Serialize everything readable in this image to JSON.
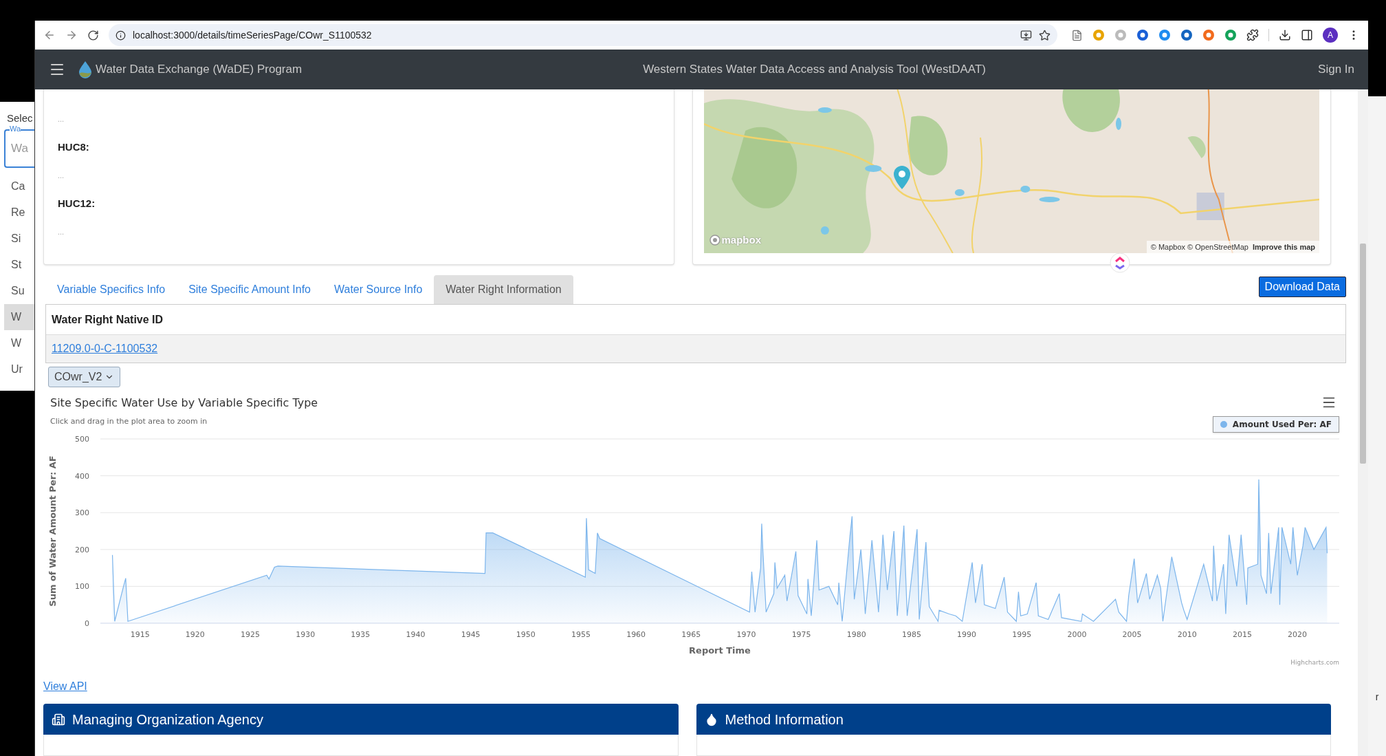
{
  "background_window": {
    "heading": "Selec",
    "field_label": "Wa",
    "field_placeholder": "Wa",
    "items": [
      {
        "label": "Ca",
        "selected": false
      },
      {
        "label": "Re",
        "selected": false
      },
      {
        "label": "Si",
        "selected": false
      },
      {
        "label": "St",
        "selected": false
      },
      {
        "label": "Su",
        "selected": false
      },
      {
        "label": "W",
        "selected": true
      },
      {
        "label": "W",
        "selected": false
      },
      {
        "label": "Ur",
        "selected": false
      }
    ],
    "side_text": "r"
  },
  "browser": {
    "url": "localhost:3000/details/timeSeriesPage/COwr_S1100532",
    "avatar": "A"
  },
  "navbar": {
    "brand": "Water Data Exchange (WaDE) Program",
    "title": "Western States Water Data Access and Analysis Tool (WestDAAT)",
    "sign_in": "Sign In"
  },
  "site_card": {
    "items": [
      {
        "kind": "value",
        "text": "..."
      },
      {
        "kind": "label",
        "text": "HUC8:"
      },
      {
        "kind": "value",
        "text": "..."
      },
      {
        "kind": "label",
        "text": "HUC12:"
      },
      {
        "kind": "value",
        "text": "..."
      }
    ]
  },
  "map": {
    "logo": "mapbox",
    "attribution": "© Mapbox © OpenStreetMap",
    "improve_link": "Improve this map"
  },
  "tabs": [
    {
      "label": "Variable Specifics Info",
      "selected": false
    },
    {
      "label": "Site Specific Amount Info",
      "selected": false
    },
    {
      "label": "Water Source Info",
      "selected": false
    },
    {
      "label": "Water Right Information",
      "selected": true
    }
  ],
  "download_button": "Download Data",
  "table": {
    "columns": [
      "Water Right Native ID"
    ],
    "rows": [
      [
        "11209.0-0-C-1100532"
      ]
    ]
  },
  "version_select": {
    "value": "COwr_V2"
  },
  "chart": {
    "subtitle": "Click and drag in the plot area to zoom in",
    "credit": "Highcharts.com",
    "chart_data": {
      "type": "area",
      "title": "Site Specific Water Use by Variable Specific Type",
      "xlabel": "Report Time",
      "ylabel": "Sum of Water Amount Per: AF",
      "x": [
        1912.5,
        1912.7,
        1913.5,
        1913.7,
        1913.9,
        1926.5,
        1926.7,
        1927.2,
        1927.5,
        1946.3,
        1946.4,
        1947,
        1955.4,
        1955.5,
        1955.7,
        1956.3,
        1956.5,
        1956.7,
        1970.3,
        1970.5,
        1970.8,
        1971.3,
        1971.4,
        1971.5,
        1971.8,
        1972.5,
        1972.6,
        1972.8,
        1973.5,
        1973.7,
        1974.5,
        1974.7,
        1975.5,
        1975.6,
        1975.9,
        1976.4,
        1976.6,
        1977.5,
        1978.3,
        1978.4,
        1978.7,
        1979.4,
        1979.6,
        1979.8,
        1980.4,
        1980.6,
        1980.8,
        1981.4,
        1982,
        1982.4,
        1982.8,
        1983.4,
        1983.7,
        1984.3,
        1984.6,
        1985.5,
        1985.7,
        1986.3,
        1986.6,
        1987.4,
        1987.5,
        1988.4,
        1989,
        1989.6,
        1990.5,
        1990.8,
        1991.4,
        1991.6,
        1992.6,
        1993.4,
        1993.7,
        1994.5,
        1994.7,
        1994.9,
        1995.5,
        1996.3,
        1996.5,
        1997.4,
        1998.4,
        1998.6,
        2000.4,
        2000.5,
        2001.5,
        2003.5,
        2003.8,
        2004.5,
        2004.7,
        2005.2,
        2005.5,
        2006.3,
        2006.6,
        2007.3,
        2007.6,
        2007.8,
        2008.6,
        2009.5,
        2009.7,
        2010,
        2011.5,
        2012.3,
        2012.4,
        2012.7,
        2013.3,
        2013.5,
        2013.8,
        2014.5,
        2014.9,
        2015.4,
        2015.5,
        2016.4,
        2016.5,
        2016.7,
        2017.2,
        2017.4,
        2017.6,
        2018.3,
        2018.4,
        2018.6,
        2019.4,
        2019.6,
        2020,
        2020.5,
        2020.7,
        2021.5,
        2022.6,
        2022.7
      ],
      "series": [
        {
          "name": "Amount Used Per: AF",
          "color": "#7cb5ec",
          "values": [
            185,
            5,
            100,
            122,
            5,
            130,
            120,
            152,
            155,
            135,
            245,
            245,
            125,
            285,
            145,
            135,
            245,
            230,
            30,
            140,
            30,
            150,
            270,
            200,
            30,
            80,
            165,
            95,
            130,
            60,
            195,
            75,
            25,
            120,
            20,
            225,
            90,
            100,
            50,
            110,
            5,
            235,
            290,
            65,
            200,
            120,
            25,
            225,
            30,
            240,
            90,
            250,
            20,
            265,
            20,
            255,
            10,
            220,
            45,
            5,
            35,
            25,
            20,
            5,
            165,
            55,
            160,
            50,
            40,
            125,
            30,
            5,
            85,
            20,
            25,
            110,
            20,
            10,
            80,
            15,
            5,
            25,
            5,
            65,
            30,
            5,
            75,
            175,
            55,
            135,
            65,
            130,
            95,
            5,
            180,
            55,
            35,
            10,
            160,
            60,
            210,
            60,
            160,
            25,
            240,
            100,
            240,
            50,
            150,
            160,
            390,
            130,
            80,
            245,
            80,
            260,
            50,
            260,
            160,
            260,
            130,
            210,
            260,
            200,
            260,
            190
          ]
        }
      ],
      "xlim": [
        1911.4,
        2023.8
      ],
      "ylim": [
        0,
        500
      ],
      "xticks": [
        1915,
        1920,
        1925,
        1930,
        1935,
        1940,
        1945,
        1950,
        1955,
        1960,
        1965,
        1970,
        1975,
        1980,
        1985,
        1990,
        1995,
        2000,
        2005,
        2010,
        2015,
        2020
      ],
      "yticks": [
        0,
        100,
        200,
        300,
        400,
        500
      ],
      "grid": true
    }
  },
  "view_api": "View API",
  "sections": [
    {
      "title": "Managing Organization Agency",
      "kind": "building"
    },
    {
      "title": "Method Information",
      "kind": "drop"
    }
  ]
}
